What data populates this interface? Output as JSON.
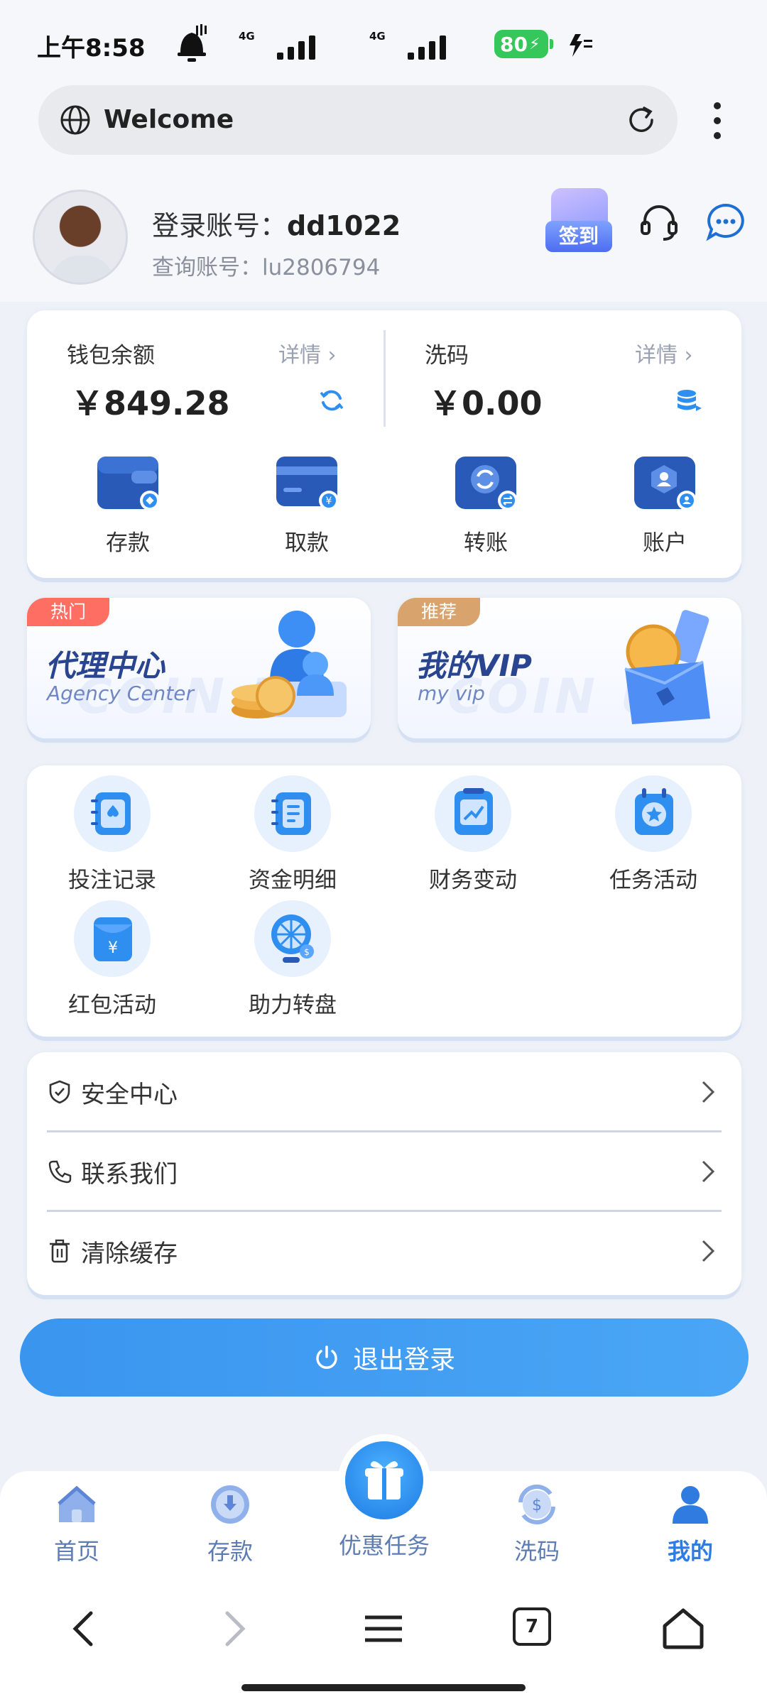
{
  "status": {
    "time": "上午8:58",
    "net1": "4G",
    "net2": "4G",
    "battery": "80"
  },
  "browser": {
    "url_title": "Welcome",
    "tabs_count": "7"
  },
  "profile": {
    "login_prefix": "登录账号：",
    "login_account": "dd1022",
    "query_label": "查询账号：lu2806794",
    "checkin_label": "签到"
  },
  "wallet": {
    "balance_label": "钱包余额",
    "balance_detail": "详情 ›",
    "balance_amount": "￥849.28",
    "wash_label": "洗码",
    "wash_detail": "详情 ›",
    "wash_amount": "￥0.00",
    "actions": [
      {
        "label": "存款",
        "icon": "wallet-deposit-icon"
      },
      {
        "label": "取款",
        "icon": "card-withdraw-icon"
      },
      {
        "label": "转账",
        "icon": "transfer-icon"
      },
      {
        "label": "账户",
        "icon": "account-icon"
      }
    ]
  },
  "promos": [
    {
      "tag": "热门",
      "title": "代理中心",
      "subtitle": "Agency Center",
      "tag_color": "#ff6e63"
    },
    {
      "tag": "推荐",
      "title": "我的VIP",
      "subtitle": "my vip",
      "tag_color": "#d8a36d"
    }
  ],
  "grid": [
    {
      "label": "投注记录",
      "icon": "bet-record-icon"
    },
    {
      "label": "资金明细",
      "icon": "fund-detail-icon"
    },
    {
      "label": "财务变动",
      "icon": "finance-change-icon"
    },
    {
      "label": "任务活动",
      "icon": "task-activity-icon"
    },
    {
      "label": "红包活动",
      "icon": "red-packet-icon"
    },
    {
      "label": "助力转盘",
      "icon": "lucky-wheel-icon"
    }
  ],
  "menu": [
    {
      "label": "安全中心",
      "icon": "shield-icon"
    },
    {
      "label": "联系我们",
      "icon": "phone-icon"
    },
    {
      "label": "清除缓存",
      "icon": "trash-icon"
    }
  ],
  "logout_label": "退出登录",
  "tabs": [
    {
      "label": "首页",
      "icon": "home-icon"
    },
    {
      "label": "存款",
      "icon": "deposit-icon"
    },
    {
      "label": "优惠任务",
      "icon": "gift-icon"
    },
    {
      "label": "洗码",
      "icon": "wash-code-icon"
    },
    {
      "label": "我的",
      "icon": "user-icon"
    }
  ],
  "colors": {
    "accent": "#2f7be0",
    "logout": "#3a95ef",
    "battery": "#35c759"
  }
}
